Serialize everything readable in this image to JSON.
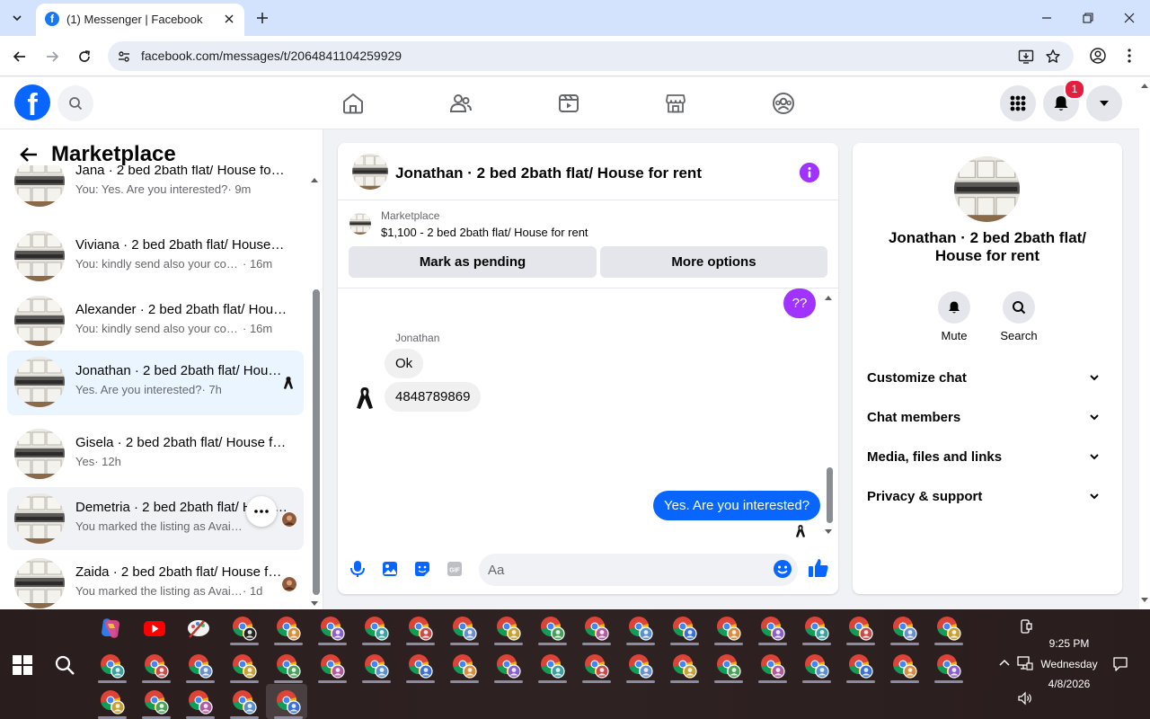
{
  "browser": {
    "tab_title": "(1) Messenger | Facebook",
    "url": "facebook.com/messages/t/2064841104259929"
  },
  "fb_header": {
    "notification_count": "1",
    "brand_color": "#0866ff"
  },
  "left_panel": {
    "title": "Marketplace",
    "conversations": [
      {
        "name": "Jana · 2 bed 2bath flat/ House for rent",
        "preview": "You: Yes. Are you interested?",
        "time": "· 9m"
      },
      {
        "name": "Viviana · 2 bed 2bath flat/ House for rent",
        "preview": "You: kindly send also your contact",
        "time": "· 16m"
      },
      {
        "name": "Alexander · 2 bed 2bath flat/ House for rent",
        "preview": "You: kindly send also your contact",
        "time": "· 16m"
      },
      {
        "name": "Jonathan · 2 bed 2bath flat/ House for rent",
        "preview": "Yes. Are you interested?",
        "time": "· 7h"
      },
      {
        "name": "Gisela · 2 bed 2bath flat/ House for rent",
        "preview": "Yes",
        "time": "· 12h"
      },
      {
        "name": "Demetria · 2 bed 2bath flat/ House for rent",
        "preview": "You marked the listing as Available",
        "time": ""
      },
      {
        "name": "Zaida · 2 bed 2bath flat/ House for rent",
        "preview": "You marked the listing as Available",
        "time": "· 1d"
      }
    ]
  },
  "chat": {
    "title": "Jonathan · 2 bed 2bath flat/ House for rent",
    "listing_source": "Marketplace",
    "listing_price": "$1,100 - 2 bed 2bath flat/ House for rent",
    "mark_pending_label": "Mark as pending",
    "more_options_label": "More options",
    "messages": [
      {
        "from": "me",
        "text": "??"
      },
      {
        "from": "them",
        "sender": "Jonathan",
        "text": "Ok"
      },
      {
        "from": "them",
        "text": "4848789869"
      },
      {
        "from": "me",
        "text": "Yes. Are you interested?"
      }
    ],
    "input_placeholder": "Aa",
    "accent_color": "#a033ff"
  },
  "info_panel": {
    "title": "Jonathan · 2 bed 2bath flat/ House for rent",
    "actions": [
      {
        "label": "Mute",
        "icon": "bell-icon"
      },
      {
        "label": "Search",
        "icon": "search-icon"
      }
    ],
    "sections": [
      "Customize chat",
      "Chat members",
      "Media, files and links",
      "Privacy & support"
    ]
  },
  "taskbar": {
    "time": "9:25 PM",
    "day": "Wednesday",
    "date": "4/8/2026"
  }
}
